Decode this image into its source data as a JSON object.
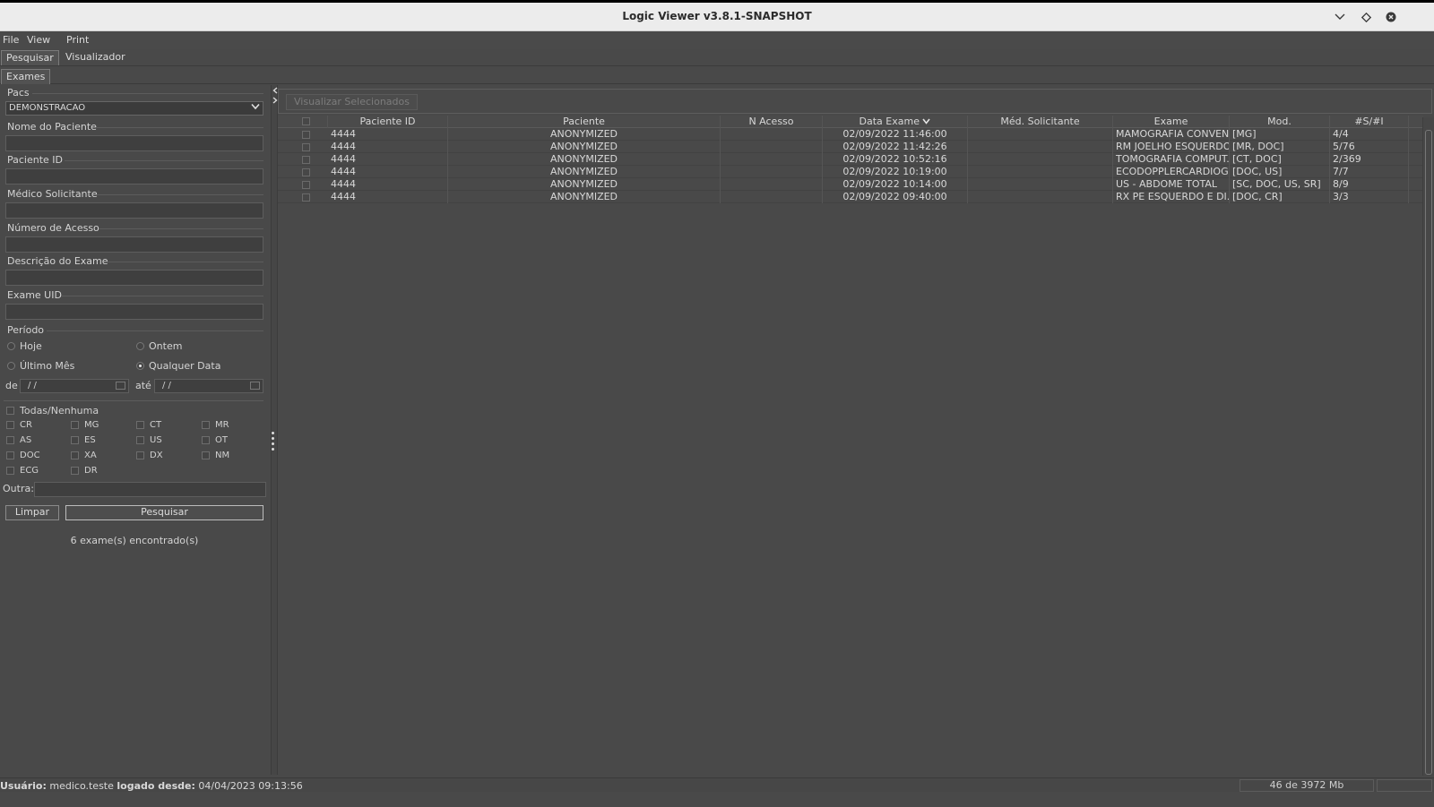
{
  "window": {
    "title": "Logic Viewer v3.8.1-SNAPSHOT",
    "controls": [
      "minimize-icon",
      "maximize-icon",
      "close-icon"
    ]
  },
  "menu": [
    "File",
    "View",
    "Print"
  ],
  "tabs": [
    "Pesquisar",
    "Visualizador"
  ],
  "subtabs": [
    "Exames"
  ],
  "search": {
    "pacs_label": "Pacs",
    "pacs_value": "DEMONSTRACAO",
    "patient_name_label": "Nome do Paciente",
    "patient_id_label": "Paciente ID",
    "requesting_doctor_label": "Médico Solicitante",
    "accession_label": "Número de Acesso",
    "exam_description_label": "Descrição do Exame",
    "exam_uid_label": "Exame UID",
    "period_label": "Período",
    "period_options": {
      "today": "Hoje",
      "yesterday": "Ontem",
      "last_month": "Último Mês",
      "any_date": "Qualquer Data"
    },
    "period_selected": "Qualquer Data",
    "from_label": "de",
    "to_label": "até",
    "from_value": "/ /",
    "to_value": "/ /",
    "all_none_label": "Todas/Nenhuma",
    "modalities": [
      [
        "CR",
        "MG",
        "CT",
        "MR"
      ],
      [
        "AS",
        "ES",
        "US",
        "OT"
      ],
      [
        "DOC",
        "XA",
        "DX",
        "NM"
      ],
      [
        "ECG",
        "DR"
      ]
    ],
    "other_label": "Outra:",
    "clear_button": "Limpar",
    "search_button": "Pesquisar",
    "results_text": "6 exame(s) encontrado(s)"
  },
  "results": {
    "view_selected_button": "Visualizar Selecionados",
    "columns": [
      "Paciente ID",
      "Paciente",
      "N Acesso",
      "Data Exame",
      "Méd. Solicitante",
      "Exame",
      "Mod.",
      "#S/#I"
    ],
    "rows": [
      {
        "patient_id": "4444",
        "patient": "ANONYMIZED",
        "accession": "",
        "date": "02/09/2022 11:46:00",
        "doctor": "",
        "exam": "MAMOGRAFIA CONVEN...",
        "mod": "[MG]",
        "series": "4/4"
      },
      {
        "patient_id": "4444",
        "patient": "ANONYMIZED",
        "accession": "",
        "date": "02/09/2022 11:42:26",
        "doctor": "",
        "exam": "RM JOELHO ESQUERDO",
        "mod": "[MR, DOC]",
        "series": "5/76"
      },
      {
        "patient_id": "4444",
        "patient": "ANONYMIZED",
        "accession": "",
        "date": "02/09/2022 10:52:16",
        "doctor": "",
        "exam": "TOMOGRAFIA COMPUT...",
        "mod": "[CT, DOC]",
        "series": "2/369"
      },
      {
        "patient_id": "4444",
        "patient": "ANONYMIZED",
        "accession": "",
        "date": "02/09/2022 10:19:00",
        "doctor": "",
        "exam": "ECODOPPLERCARDIOG...",
        "mod": "[DOC, US]",
        "series": "7/7"
      },
      {
        "patient_id": "4444",
        "patient": "ANONYMIZED",
        "accession": "",
        "date": "02/09/2022 10:14:00",
        "doctor": "",
        "exam": "US - ABDOME TOTAL",
        "mod": "[SC, DOC, US, SR]",
        "series": "8/9"
      },
      {
        "patient_id": "4444",
        "patient": "ANONYMIZED",
        "accession": "",
        "date": "02/09/2022 09:40:00",
        "doctor": "",
        "exam": "RX PE ESQUERDO E DI...",
        "mod": "[DOC, CR]",
        "series": "3/3"
      }
    ]
  },
  "status": {
    "user_label": "Usuário:",
    "user_value": "medico.teste",
    "logged_label": "logado desde:",
    "logged_value": "04/04/2023 09:13:56",
    "memory": "46 de 3972 Mb"
  },
  "colors": {
    "background": "#494949",
    "titlebar": "#ececec",
    "text": "#d8d8d8"
  }
}
